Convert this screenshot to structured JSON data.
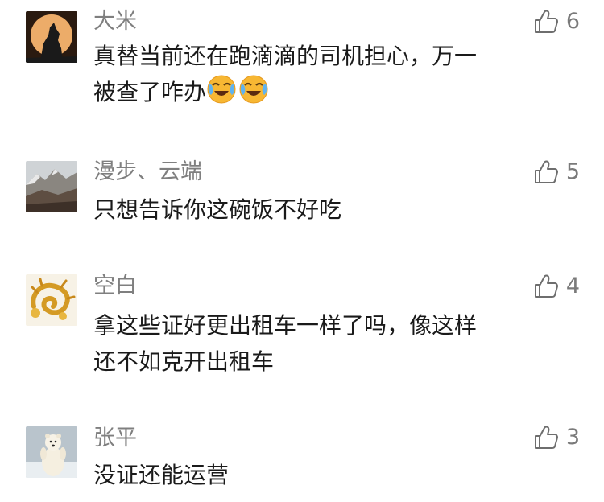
{
  "comments": [
    {
      "name": "大米",
      "avatar_icon": "wolf-moon-avatar",
      "likes": "6",
      "lines": [
        "真替当前还在跑滴滴的司机担心，万一",
        "被查了咋办"
      ],
      "emoji_icon": "laughing-crying-emoji",
      "emoji_count": 2
    },
    {
      "name": "漫步、云端",
      "avatar_icon": "mountain-landscape-avatar",
      "likes": "5",
      "lines": [
        "只想告诉你这碗饭不好吃"
      ]
    },
    {
      "name": "空白",
      "avatar_icon": "golden-dragon-avatar",
      "likes": "4",
      "lines": [
        "拿这些证好更出租车一样了吗，像这样",
        "还不如克开出租车"
      ]
    },
    {
      "name": "张平",
      "avatar_icon": "polar-bear-avatar",
      "likes": "3",
      "lines": [
        "没证还能运营"
      ]
    }
  ],
  "icons": {
    "like": "thumbs-up-icon"
  },
  "colors": {
    "name": "#7f7f7f",
    "text": "#1a1a1a",
    "like": "#6e6e6e"
  }
}
